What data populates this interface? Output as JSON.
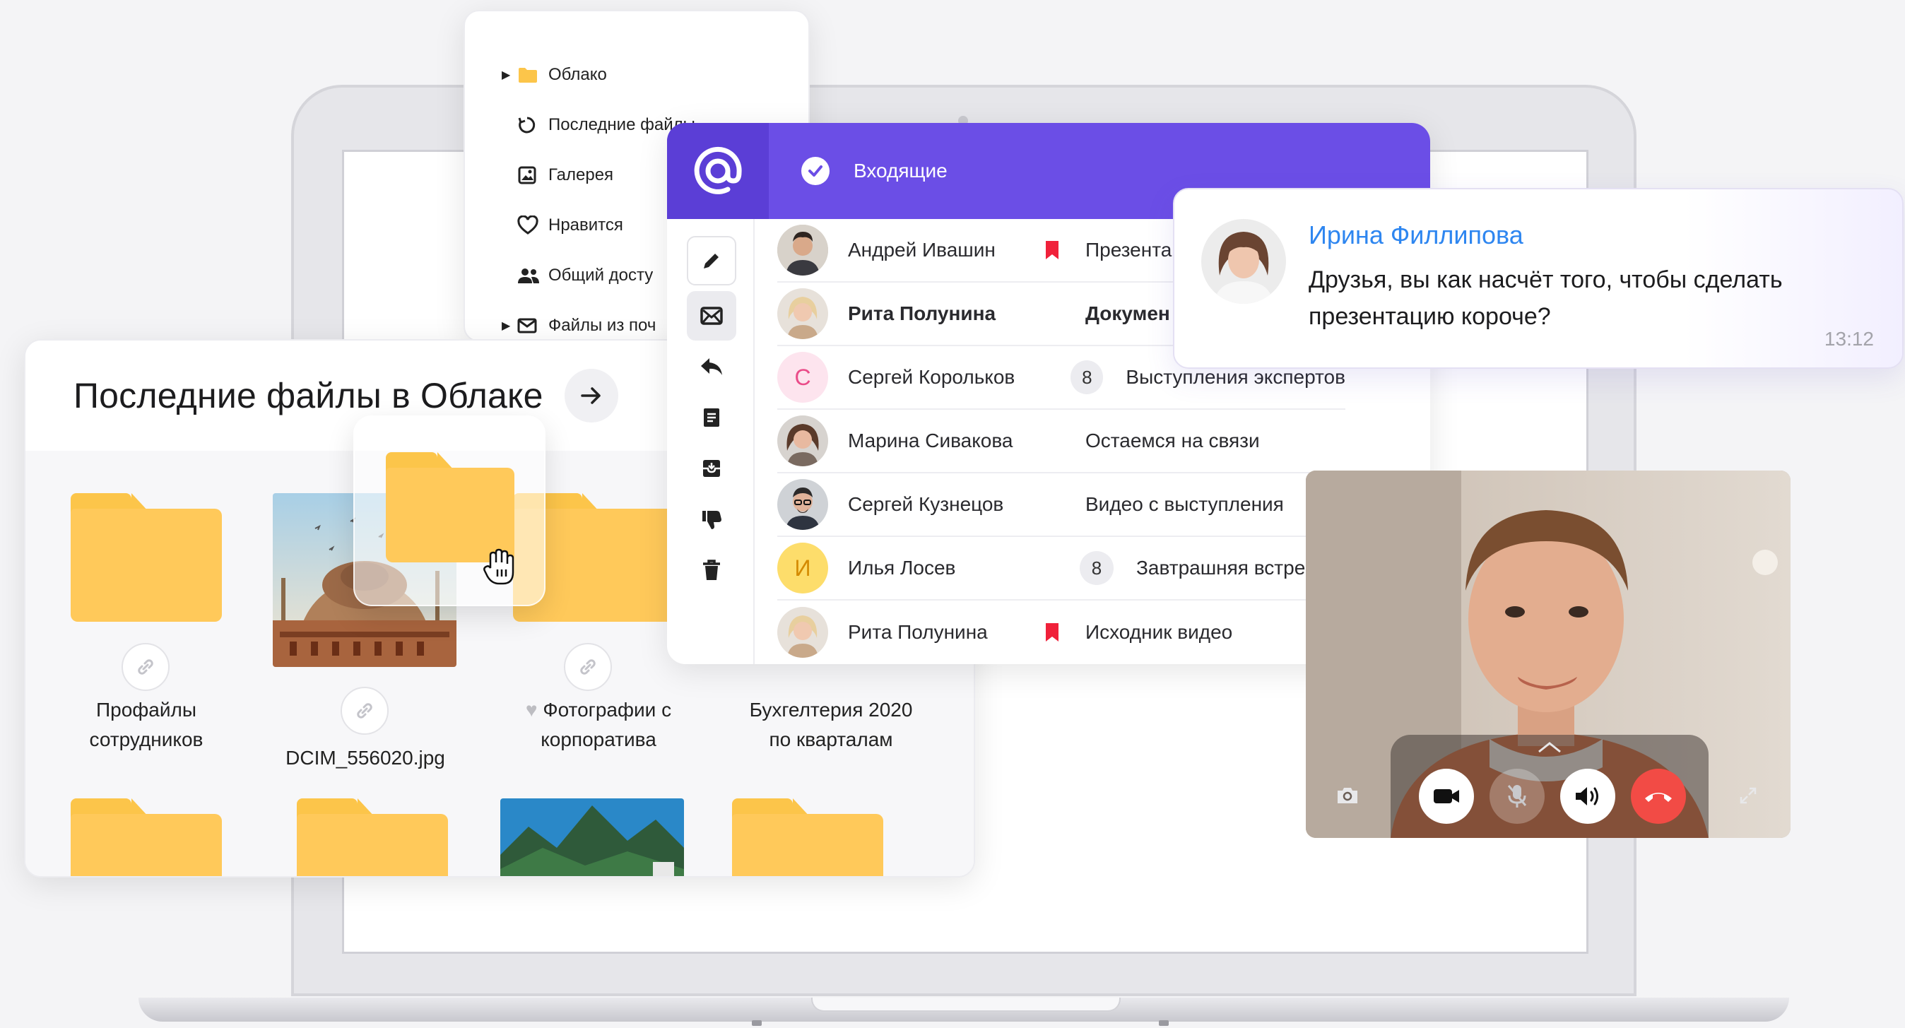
{
  "cloud_sidebar": {
    "items": [
      {
        "label": "Облако",
        "icon": "folder-icon",
        "expandable": true
      },
      {
        "label": "Последние файлы",
        "icon": "history-icon",
        "expandable": false
      },
      {
        "label": "Галерея",
        "icon": "gallery-icon",
        "expandable": false
      },
      {
        "label": "Нравится",
        "icon": "heart-icon",
        "expandable": false
      },
      {
        "label": "Общий досту",
        "icon": "people-icon",
        "expandable": false
      },
      {
        "label": "Файлы из поч",
        "icon": "mail-icon",
        "expandable": true
      }
    ]
  },
  "recent_files": {
    "title": "Последние файлы в Облаке",
    "items": [
      {
        "label_line1": "Профайлы",
        "label_line2": "сотрудников",
        "type": "folder"
      },
      {
        "label_line1": "DCIM_556020.jpg",
        "label_line2": "",
        "type": "photo"
      },
      {
        "label_line1": "Фотографии с",
        "label_line2": "корпоратива",
        "type": "folder",
        "liked": true
      },
      {
        "label_line1": "Бухгелтерия 2020",
        "label_line2": "по кварталам",
        "type": "folder"
      }
    ]
  },
  "mail": {
    "header_label": "Входящие",
    "rows": [
      {
        "sender": "Андрей Ивашин",
        "subject": "Презента",
        "flag": true,
        "count": "",
        "bold": false
      },
      {
        "sender": "Рита Полунина",
        "subject": "Докумен",
        "flag": false,
        "count": "",
        "bold": true
      },
      {
        "sender": "Сергей Корольков",
        "subject": "Выступления экспертов",
        "flag": false,
        "count": "8",
        "bold": false,
        "initial": "С"
      },
      {
        "sender": "Марина Сивакова",
        "subject": "Остаемся на связи",
        "flag": false,
        "count": "",
        "bold": false
      },
      {
        "sender": "Сергей Кузнецов",
        "subject": "Видео с выступления",
        "flag": false,
        "count": "",
        "bold": false
      },
      {
        "sender": "Илья Лосев",
        "subject": "Завтрашняя встреча",
        "flag": false,
        "count": "8",
        "bold": false,
        "initial": "И"
      },
      {
        "sender": "Рита Полунина",
        "subject": "Исходник видео",
        "flag": true,
        "count": "",
        "bold": false
      }
    ]
  },
  "chat": {
    "name": "Ирина Филлипова",
    "line1": "Друзья, вы как насчёт того, чтобы сделать",
    "line2": "презентацию короче?",
    "time": "13:12"
  },
  "colors": {
    "mail_accent": "#6b4ee6",
    "folder": "#ffc95a",
    "flag": "#f0213a",
    "hangup": "#f24b45",
    "chat_name": "#2e86f0"
  }
}
